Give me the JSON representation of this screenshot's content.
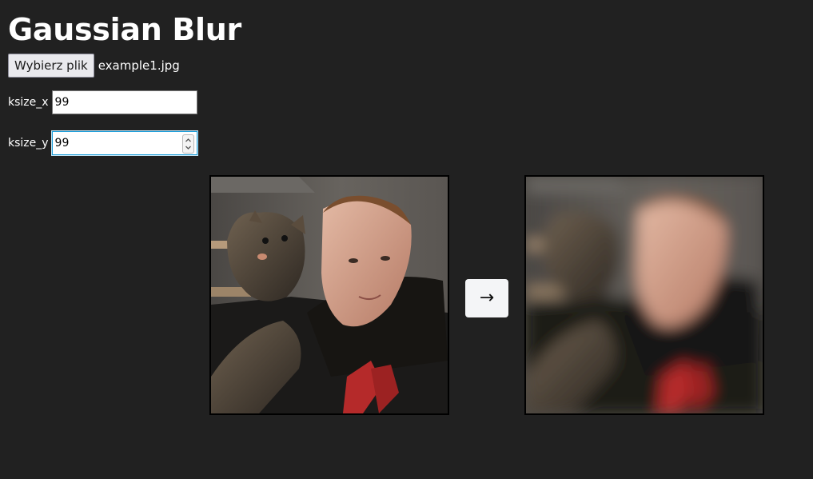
{
  "title": "Gaussian Blur",
  "file": {
    "button_label": "Wybierz plik",
    "file_name": "example1.jpg"
  },
  "ksize_x": {
    "label": "ksize_x",
    "value": "99"
  },
  "ksize_y": {
    "label": "ksize_y",
    "value": "99"
  },
  "arrow": "→",
  "colors": {
    "background": "#212121",
    "input_focus": "#1a9cd8",
    "image_border": "#000000"
  }
}
